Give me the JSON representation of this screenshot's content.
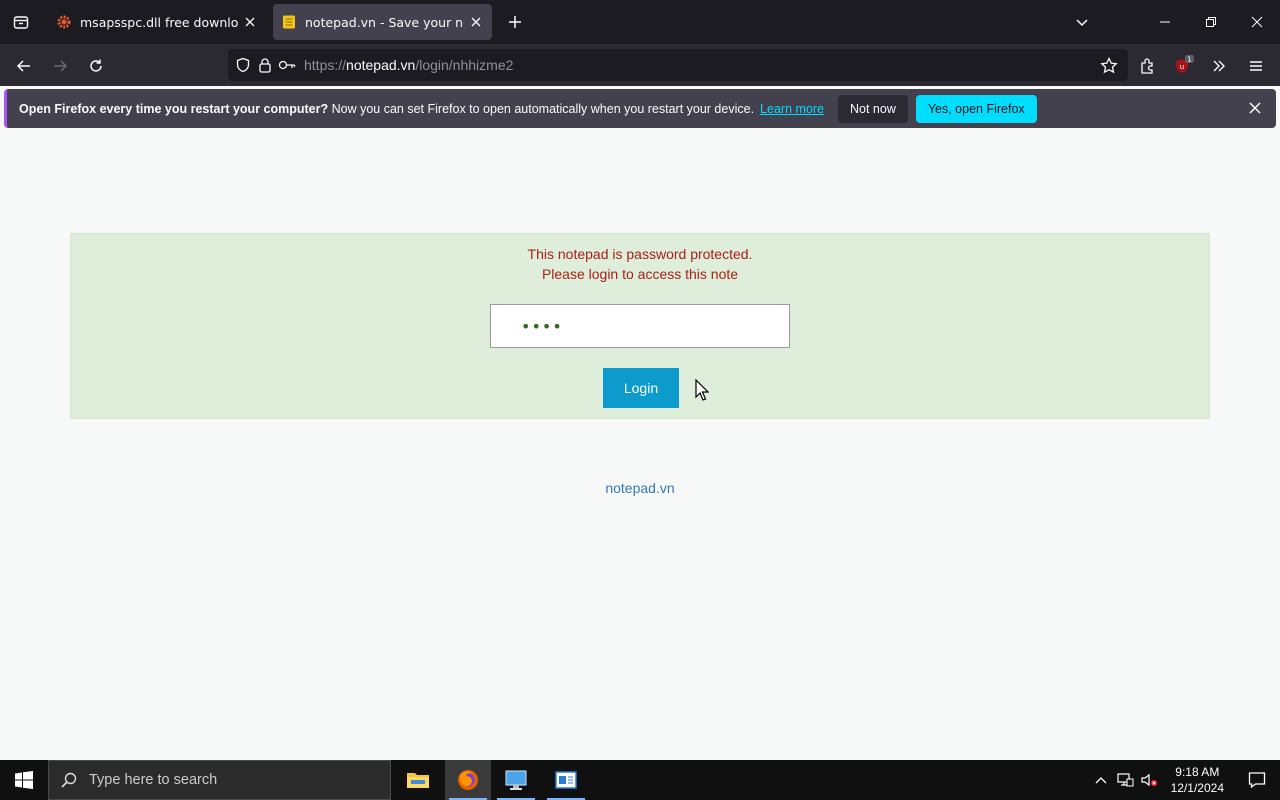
{
  "browser": {
    "tabs": [
      {
        "title": "msapsspc.dll free download | DLL",
        "favicon": "gear-icon"
      },
      {
        "title": "notepad.vn - Save your notes, Sh",
        "favicon": "notepad-icon",
        "active": true
      }
    ],
    "url": {
      "scheme": "https://",
      "host": "notepad.vn",
      "path": "/login/nhhizme2"
    },
    "extension_badge": "1"
  },
  "notification": {
    "bold_text": "Open Firefox every time you restart your computer?",
    "text": "Now you can set Firefox to open automatically when you restart your device.",
    "learn_more": "Learn more",
    "not_now": "Not now",
    "yes": "Yes, open Firefox"
  },
  "page": {
    "message_line1": "This notepad is password protected.",
    "message_line2": "Please login to access this note",
    "password_value": "••••",
    "login_button": "Login",
    "footer_link": "notepad.vn"
  },
  "taskbar": {
    "search_placeholder": "Type here to search",
    "time": "9:18 AM",
    "date": "12/1/2024"
  },
  "colors": {
    "accent": "#00ddff",
    "message_red": "#a81f14",
    "box_green": "#dfeedb",
    "login_blue": "#0d9bcd"
  }
}
